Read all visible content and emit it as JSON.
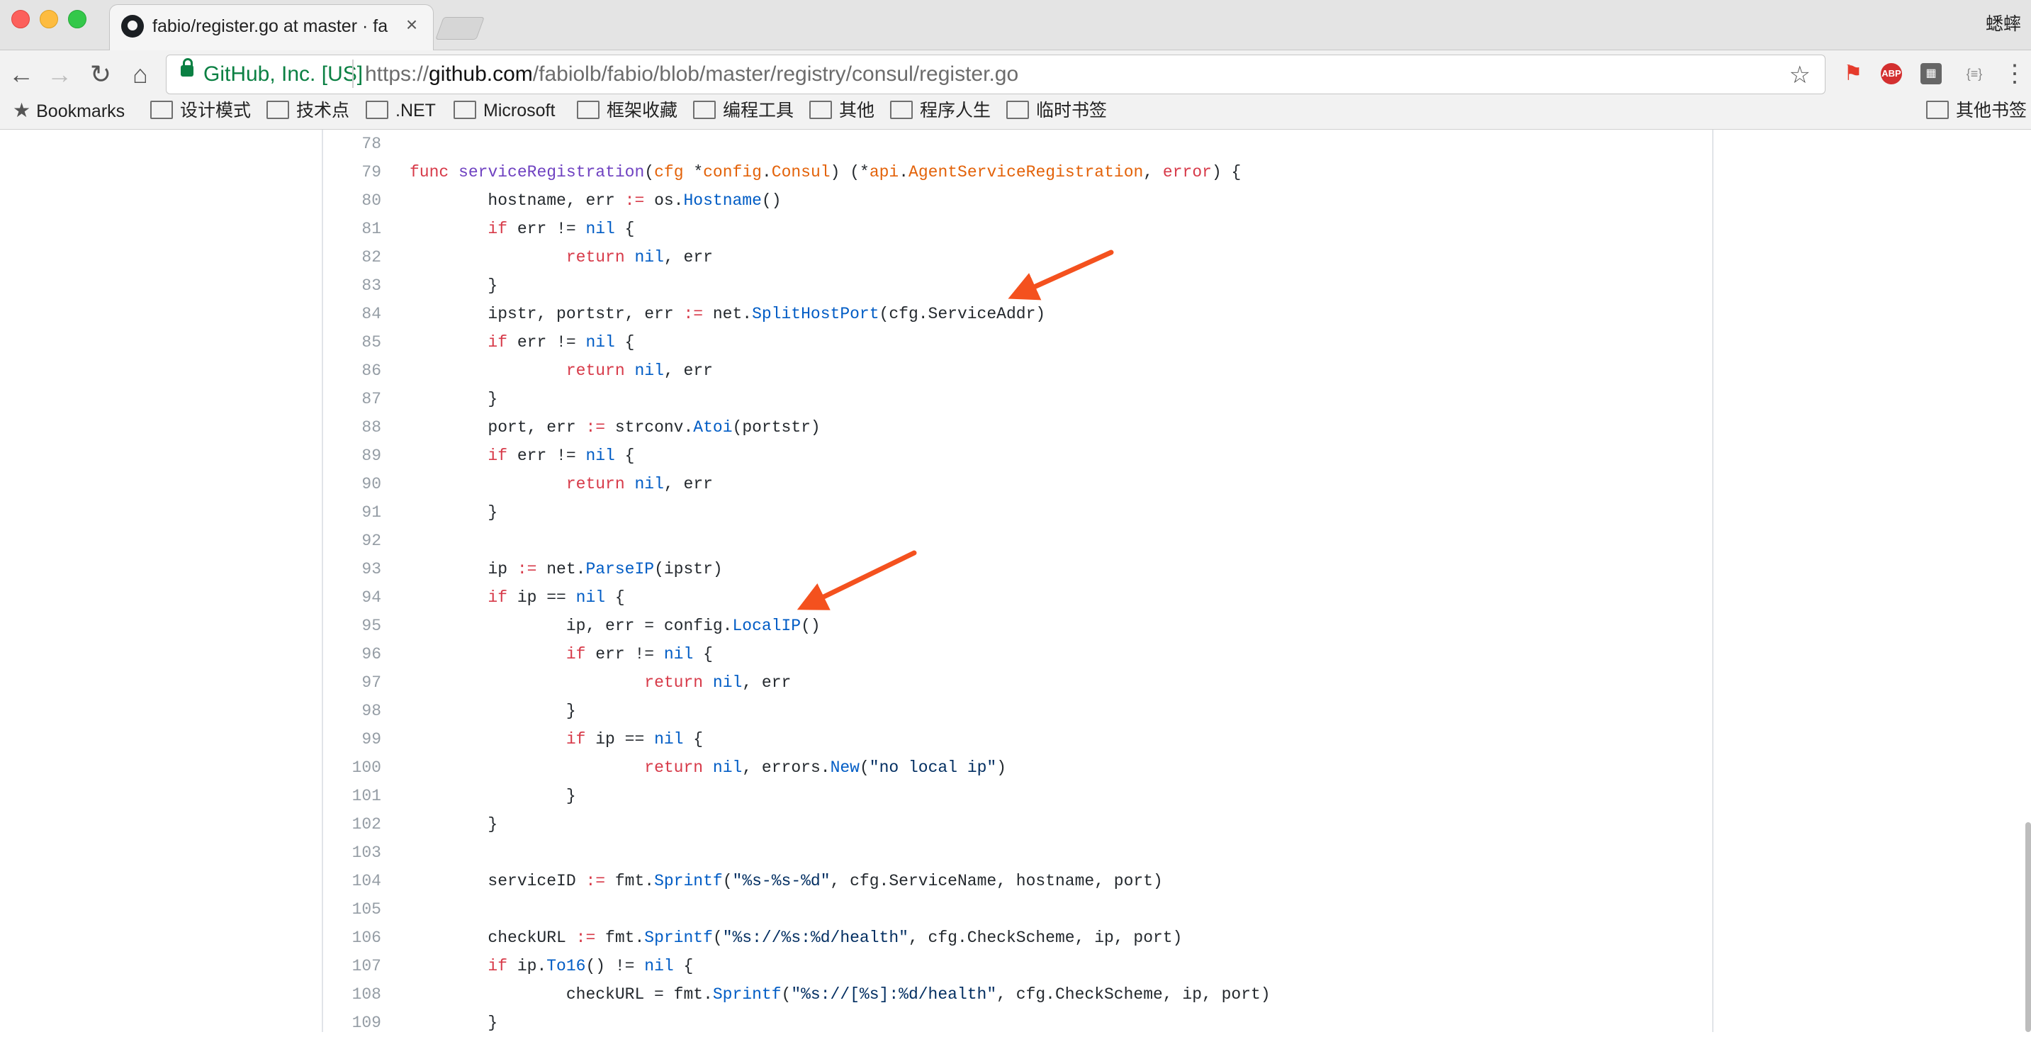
{
  "tab": {
    "title": "fabio/register.go at master · fa",
    "close_glyph": "×"
  },
  "profile_name": "蟋蟀",
  "toolbar": {
    "secure_label": "GitHub, Inc. [US]",
    "url_scheme": "https://",
    "url_host": "github.com",
    "url_path": "/fabiolb/fabio/blob/master/registry/consul/register.go",
    "back_icon": "←",
    "forward_icon": "→",
    "reload_icon": "↻",
    "home_icon": "⌂",
    "star_icon": "☆",
    "abp_label": "ABP",
    "json_label": "{≡}",
    "menu_icon": "⋮"
  },
  "bookmarks": {
    "items": [
      {
        "label": "Bookmarks"
      },
      {
        "label": "设计模式"
      },
      {
        "label": "技术点"
      },
      {
        "label": ".NET"
      },
      {
        "label": "Microsoft"
      },
      {
        "label": "框架收藏"
      },
      {
        "label": "编程工具"
      },
      {
        "label": "其他"
      },
      {
        "label": "程序人生"
      },
      {
        "label": "临时书签"
      }
    ],
    "other": "其他书签"
  },
  "code": {
    "lines": [
      {
        "n": "78",
        "t": ""
      },
      {
        "n": "79",
        "t": "func serviceRegistration(cfg *config.Consul) (*api.AgentServiceRegistration, error) {"
      },
      {
        "n": "80",
        "t": "        hostname, err := os.Hostname()"
      },
      {
        "n": "81",
        "t": "        if err != nil {"
      },
      {
        "n": "82",
        "t": "                return nil, err"
      },
      {
        "n": "83",
        "t": "        }"
      },
      {
        "n": "84",
        "t": "        ipstr, portstr, err := net.SplitHostPort(cfg.ServiceAddr)"
      },
      {
        "n": "85",
        "t": "        if err != nil {"
      },
      {
        "n": "86",
        "t": "                return nil, err"
      },
      {
        "n": "87",
        "t": "        }"
      },
      {
        "n": "88",
        "t": "        port, err := strconv.Atoi(portstr)"
      },
      {
        "n": "89",
        "t": "        if err != nil {"
      },
      {
        "n": "90",
        "t": "                return nil, err"
      },
      {
        "n": "91",
        "t": "        }"
      },
      {
        "n": "92",
        "t": ""
      },
      {
        "n": "93",
        "t": "        ip := net.ParseIP(ipstr)"
      },
      {
        "n": "94",
        "t": "        if ip == nil {"
      },
      {
        "n": "95",
        "t": "                ip, err = config.LocalIP()"
      },
      {
        "n": "96",
        "t": "                if err != nil {"
      },
      {
        "n": "97",
        "t": "                        return nil, err"
      },
      {
        "n": "98",
        "t": "                }"
      },
      {
        "n": "99",
        "t": "                if ip == nil {"
      },
      {
        "n": "100",
        "t": "                        return nil, errors.New(\"no local ip\")"
      },
      {
        "n": "101",
        "t": "                }"
      },
      {
        "n": "102",
        "t": "        }"
      },
      {
        "n": "103",
        "t": ""
      },
      {
        "n": "104",
        "t": "        serviceID := fmt.Sprintf(\"%s-%s-%d\", cfg.ServiceName, hostname, port)"
      },
      {
        "n": "105",
        "t": ""
      },
      {
        "n": "106",
        "t": "        checkURL := fmt.Sprintf(\"%s://%s:%d/health\", cfg.CheckScheme, ip, port)"
      },
      {
        "n": "107",
        "t": "        if ip.To16() != nil {"
      },
      {
        "n": "108",
        "t": "                checkURL = fmt.Sprintf(\"%s://[%s]:%d/health\", cfg.CheckScheme, ip, port)"
      },
      {
        "n": "109",
        "t": "        }"
      }
    ]
  },
  "colors": {
    "keyword": "#d73a49",
    "function": "#6f42c1",
    "call": "#005cc5",
    "string": "#032f62",
    "type": "#e36209",
    "annotation_arrow": "#f4511e"
  }
}
